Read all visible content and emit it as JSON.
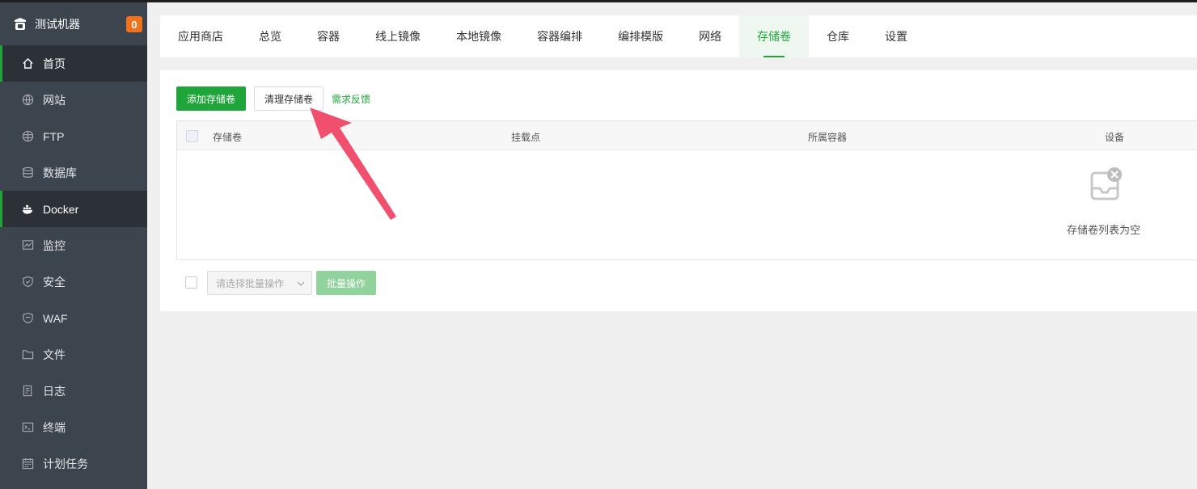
{
  "app": {
    "title": "测试机器",
    "badge": "0"
  },
  "sidebar": {
    "items": [
      {
        "label": "首页",
        "icon": "home-icon",
        "active": true
      },
      {
        "label": "网站",
        "icon": "globe-icon"
      },
      {
        "label": "FTP",
        "icon": "ftp-globe-icon"
      },
      {
        "label": "数据库",
        "icon": "database-icon"
      },
      {
        "label": "Docker",
        "icon": "docker-icon",
        "active": true
      },
      {
        "label": "监控",
        "icon": "monitor-chart-icon"
      },
      {
        "label": "安全",
        "icon": "shield-check-icon"
      },
      {
        "label": "WAF",
        "icon": "shield-icon"
      },
      {
        "label": "文件",
        "icon": "folder-icon"
      },
      {
        "label": "日志",
        "icon": "log-file-icon"
      },
      {
        "label": "终端",
        "icon": "terminal-icon"
      },
      {
        "label": "计划任务",
        "icon": "calendar-icon"
      }
    ]
  },
  "tabs": [
    "应用商店",
    "总览",
    "容器",
    "线上镜像",
    "本地镜像",
    "容器编排",
    "编排模版",
    "网络",
    "存储卷",
    "仓库",
    "设置"
  ],
  "active_tab": "存储卷",
  "toolbar": {
    "add_label": "添加存储卷",
    "clean_label": "清理存储卷",
    "feedback_label": "需求反馈"
  },
  "table": {
    "columns": [
      "存储卷",
      "挂载点",
      "所属容器",
      "设备"
    ],
    "empty_text": "存储卷列表为空"
  },
  "footer": {
    "batch_placeholder": "请选择批量操作",
    "batch_button": "批量操作"
  },
  "colors": {
    "accent": "#20a53a",
    "sidebar_bg": "#3c444d",
    "badge": "#f0721d",
    "annotation_arrow": "#f0506e"
  }
}
